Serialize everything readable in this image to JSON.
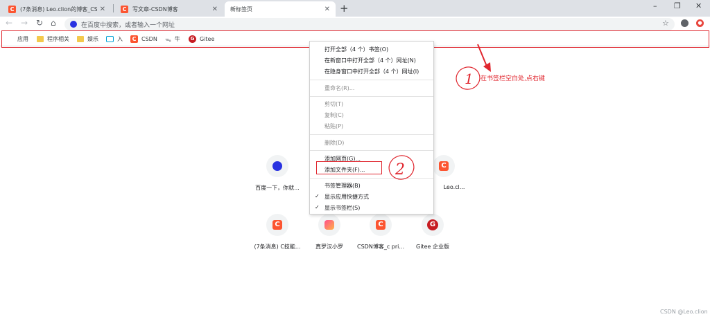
{
  "tabs": [
    {
      "label": "(7条消息) Leo.clion的博客_CSDN",
      "active": false
    },
    {
      "label": "写文章-CSDN博客",
      "active": false
    },
    {
      "label": "新标签页",
      "active": true
    }
  ],
  "window_controls": {
    "minimize": "–",
    "restore": "❐",
    "close": "✕"
  },
  "omnibox": {
    "placeholder": "在百度中搜索，或者输入一个网址"
  },
  "bookmarks": [
    {
      "label": "应用",
      "icon": "apps-grid-icon"
    },
    {
      "label": "程序相关",
      "icon": "folder-icon"
    },
    {
      "label": "娱乐",
      "icon": "folder-icon"
    },
    {
      "label": "入",
      "icon": "bilibili-icon"
    },
    {
      "label": "CSDN",
      "icon": "csdn-icon"
    },
    {
      "label": "牛",
      "icon": "nowcoder-icon"
    },
    {
      "label": "Gitee",
      "icon": "gitee-icon"
    }
  ],
  "context_menu": {
    "items": [
      {
        "label": "打开全部（4 个）书签(O)",
        "enabled": true
      },
      {
        "label": "在新窗口中打开全部（4 个）网址(N)",
        "enabled": true
      },
      {
        "label": "在隐身窗口中打开全部（4 个）网址(I)",
        "enabled": true
      },
      {
        "label": "重命名(R)...",
        "enabled": false
      },
      {
        "label": "剪切(T)",
        "enabled": false
      },
      {
        "label": "复制(C)",
        "enabled": false
      },
      {
        "label": "粘贴(P)",
        "enabled": false
      },
      {
        "label": "删除(D)",
        "enabled": false
      },
      {
        "label": "添加网页(G)...",
        "enabled": true
      },
      {
        "label": "添加文件夹(F)...",
        "enabled": true,
        "highlighted": true
      },
      {
        "label": "书签管理器(B)",
        "enabled": true
      },
      {
        "label": "显示应用快捷方式",
        "enabled": true,
        "checked": true
      },
      {
        "label": "显示书签栏(S)",
        "enabled": true,
        "checked": true
      }
    ]
  },
  "shortcuts": [
    {
      "label": "百度一下，你就...",
      "icon": "baidu-icon"
    },
    {
      "label": "Leo.cl...",
      "icon": "csdn-icon"
    },
    {
      "label": "(7条消息) C技能...",
      "icon": "csdn-icon"
    },
    {
      "label": "真罗汉小罗",
      "icon": "video-play-icon"
    },
    {
      "label": "CSDN博客_c pri...",
      "icon": "csdn-icon"
    },
    {
      "label": "Gitee 企业版",
      "icon": "gitee-icon"
    }
  ],
  "annotations": {
    "step1_text": "在书签栏空白处,点右键",
    "step1_number": "1",
    "step2_number": "2"
  },
  "watermark": "CSDN @Leo.clion",
  "colors": {
    "annotation_red": "#e0262e",
    "csdn_orange": "#fc5531",
    "gitee_red": "#c71d23",
    "baidu_blue": "#2932e1"
  }
}
